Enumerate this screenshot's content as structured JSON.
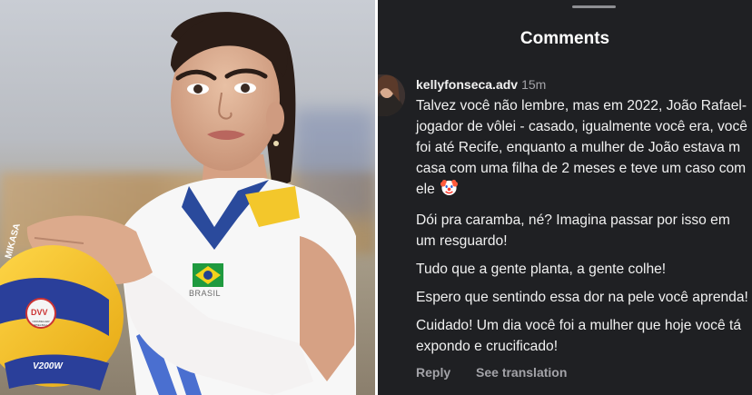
{
  "photo": {
    "ball_labels": {
      "brand": "MIKASA",
      "seal": "DVV",
      "seal_sub": "OFFIZIELLER SPIELBALL",
      "model": "V200W"
    },
    "jersey_text": "BRASIL",
    "colors": {
      "jersey": "#f7f7f7",
      "trim": "#2a4a9c",
      "accent": "#f3c72b"
    }
  },
  "comments_panel": {
    "title": "Comments",
    "comment": {
      "username": "kellyfonseca.adv",
      "time": "15m",
      "paragraphs": [
        "Talvez você não lembre, mas em 2022, João Rafael- jogador de vôlei - casado, igualmente você era, você foi até Recife, enquanto a mulher de João estava m casa com uma filha de 2 meses e teve um caso com ele",
        "Dói pra caramba, né? Imagina passar por isso em um resguardo!",
        "Tudo que a gente planta, a gente colhe!",
        "Espero que sentindo essa dor na pele você aprenda!",
        "Cuidado! Um dia você foi a mulher que hoje você tá expondo e crucificado!"
      ],
      "emoji_icon": "clown-face-icon"
    },
    "actions": {
      "reply": "Reply",
      "see_translation": "See translation"
    },
    "colors": {
      "background": "#1f2023",
      "text": "#f1f1f1",
      "muted": "#a3a3a8"
    }
  }
}
